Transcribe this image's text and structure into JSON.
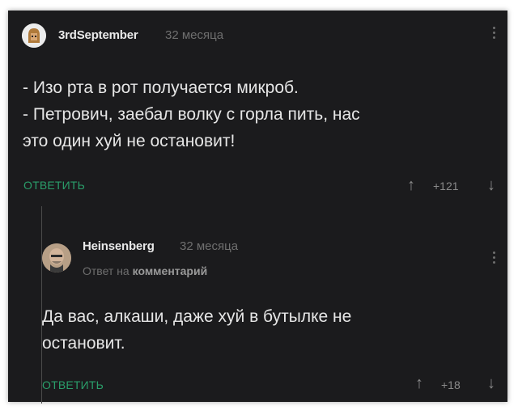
{
  "comment1": {
    "username": "3rdSeptember",
    "time": "32 месяца",
    "lines": [
      "- Изо рта в рот получается микроб.",
      "- Петрович, заебал волку с горла пить, нас",
      "это один хуй не остановит!"
    ],
    "reply_label": "ОТВЕТИТЬ",
    "score": "+121"
  },
  "comment2": {
    "username": "Heinsenberg",
    "time": "32 месяца",
    "reply_to_prefix": "Ответ на",
    "reply_to_target": "комментарий",
    "lines": [
      "Да вас, алкаши, даже хуй в бутылке не",
      "остановит."
    ],
    "reply_label": "ОТВЕТИТЬ",
    "score": "+18"
  },
  "icons": {
    "upvote": "arrow-up-icon",
    "downvote": "arrow-down-icon",
    "menu": "kebab-menu-icon"
  },
  "colors": {
    "background": "#1b1b1d",
    "reply_accent": "#2a9e6a"
  }
}
